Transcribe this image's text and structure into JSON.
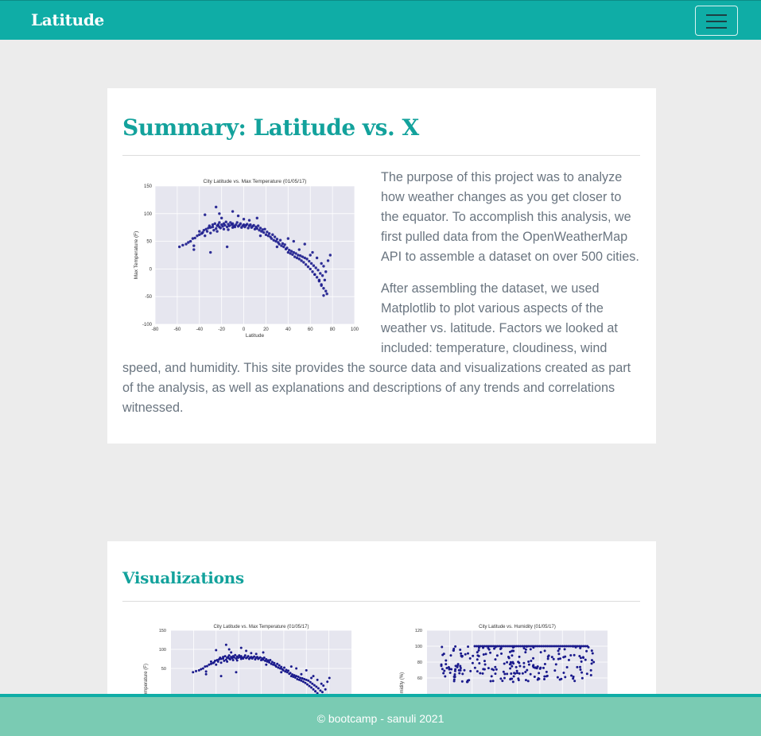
{
  "navbar": {
    "brand": "Latitude",
    "menu_icon": "hamburger-menu-icon"
  },
  "summary": {
    "title": "Summary: Latitude vs. X",
    "paragraph1": "The purpose of this project was to analyze how weather changes as you get closer to the equator. To accomplish this analysis, we first pulled data from the OpenWeatherMap API to assemble a dataset on over 500 cities.",
    "paragraph2": "After assembling the dataset, we used Matplotlib to plot various aspects of the weather vs. latitude. Factors we looked at included: temperature, cloudiness, wind speed, and humidity. This site provides the source data and visualizations created as part of the analysis, as well as explanations and descriptions of any trends and correlations witnessed."
  },
  "visualizations": {
    "title": "Visualizations"
  },
  "footer": {
    "text": "© bootcamp - sanuli 2021"
  },
  "colors": {
    "brand": "#0fada6",
    "heading": "#13a29c",
    "footer": "#7acbb3",
    "marker": "#1a1a8c",
    "plot_bg": "#e6e6ef"
  },
  "chart_data": [
    {
      "type": "scatter",
      "title": "City Latitude vs. Max Temperature (01/05/17)",
      "xlabel": "Latitude",
      "ylabel": "Max Temperature (F)",
      "xlim": [
        -80,
        100
      ],
      "ylim": [
        -100,
        150
      ],
      "xticks": [
        -80,
        -60,
        -40,
        -20,
        0,
        20,
        40,
        60,
        80,
        100
      ],
      "yticks": [
        -100,
        -50,
        0,
        50,
        100,
        150
      ],
      "grid": true,
      "series": [
        {
          "x": [
            -58,
            -55,
            -52,
            -50,
            -48,
            -46,
            -45,
            -44,
            -42,
            -40,
            -40,
            -38,
            -37,
            -36,
            -35,
            -34,
            -33,
            -32,
            -31,
            -30,
            -30,
            -28,
            -28,
            -27,
            -26,
            -25,
            -24,
            -24,
            -23,
            -22,
            -22,
            -21,
            -20,
            -19,
            -18,
            -18,
            -17,
            -16,
            -15,
            -14,
            -14,
            -13,
            -12,
            -11,
            -10,
            -10,
            -9,
            -8,
            -7,
            -6,
            -5,
            -4,
            -3,
            -2,
            -1,
            0,
            1,
            2,
            3,
            4,
            5,
            6,
            7,
            8,
            9,
            10,
            11,
            12,
            13,
            14,
            15,
            16,
            17,
            18,
            19,
            20,
            21,
            22,
            23,
            24,
            25,
            26,
            27,
            28,
            29,
            30,
            31,
            32,
            33,
            34,
            35,
            36,
            37,
            38,
            39,
            40,
            41,
            42,
            43,
            44,
            45,
            46,
            47,
            48,
            49,
            50,
            51,
            52,
            53,
            54,
            55,
            56,
            57,
            58,
            59,
            60,
            61,
            62,
            63,
            64,
            65,
            66,
            67,
            68,
            69,
            70,
            71,
            72,
            73,
            74,
            75,
            -35,
            -20,
            -22,
            -25,
            -10,
            -5,
            0,
            5,
            12,
            30,
            45,
            55,
            62,
            66,
            70,
            72,
            -45,
            -30,
            -15,
            15,
            40,
            50,
            60,
            64,
            68,
            70,
            72,
            74,
            76,
            78
          ],
          "y": [
            40,
            43,
            45,
            48,
            50,
            55,
            42,
            56,
            60,
            62,
            68,
            64,
            66,
            70,
            60,
            72,
            68,
            74,
            78,
            75,
            65,
            80,
            76,
            70,
            82,
            73,
            78,
            68,
            80,
            76,
            84,
            74,
            80,
            77,
            82,
            72,
            79,
            85,
            76,
            81,
            71,
            78,
            84,
            80,
            75,
            82,
            78,
            76,
            80,
            84,
            77,
            79,
            82,
            75,
            78,
            80,
            76,
            79,
            81,
            74,
            78,
            80,
            75,
            77,
            79,
            72,
            76,
            73,
            78,
            70,
            74,
            68,
            71,
            66,
            72,
            62,
            67,
            60,
            64,
            58,
            55,
            62,
            52,
            58,
            50,
            54,
            48,
            45,
            52,
            42,
            46,
            40,
            44,
            36,
            38,
            30,
            34,
            28,
            32,
            26,
            30,
            22,
            28,
            20,
            25,
            18,
            24,
            15,
            22,
            12,
            20,
            8,
            18,
            4,
            14,
            0,
            10,
            -5,
            6,
            -10,
            2,
            -15,
            -2,
            -22,
            -8,
            -28,
            -12,
            -35,
            -20,
            -40,
            -45,
            98,
            92,
            100,
            112,
            104,
            96,
            90,
            88,
            92,
            40,
            50,
            45,
            30,
            20,
            -30,
            -48,
            35,
            30,
            40,
            60,
            55,
            35,
            25,
            -10,
            -20,
            10,
            5,
            -5,
            15,
            25
          ]
        }
      ]
    },
    {
      "type": "scatter",
      "title": "City Latitude vs. Max Temperature (01/05/17)",
      "ylabel": "Max Temperature (F)",
      "yticks": [
        50,
        100,
        150
      ],
      "ylim": [
        -100,
        150
      ]
    },
    {
      "type": "scatter",
      "title": "City Latitude vs. Humidity (01/05/17)",
      "ylabel": "Humidity (%)",
      "yticks": [
        60,
        80,
        100,
        120
      ],
      "ylim": [
        0,
        120
      ]
    }
  ]
}
